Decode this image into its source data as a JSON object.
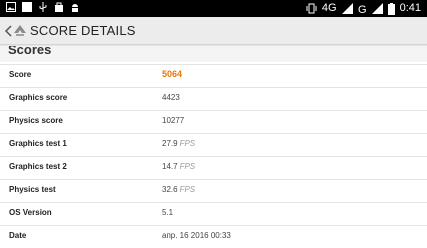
{
  "status_bar": {
    "network": "4G",
    "time": "0:41"
  },
  "app_bar": {
    "title": "SCORE DETAILS"
  },
  "section": {
    "title": "Scores"
  },
  "rows": [
    {
      "label": "Score",
      "value": "5064",
      "unit": ""
    },
    {
      "label": "Graphics score",
      "value": "4423",
      "unit": ""
    },
    {
      "label": "Physics score",
      "value": "10277",
      "unit": ""
    },
    {
      "label": "Graphics test 1",
      "value": "27.9",
      "unit": "FPS"
    },
    {
      "label": "Graphics test 2",
      "value": "14.7",
      "unit": "FPS"
    },
    {
      "label": "Physics test",
      "value": "32.6",
      "unit": "FPS"
    },
    {
      "label": "OS Version",
      "value": "5.1",
      "unit": ""
    },
    {
      "label": "Date",
      "value": "апр. 16 2016 00:33",
      "unit": ""
    }
  ],
  "colors": {
    "accent": "#e8760c",
    "statusbar": "#000000"
  }
}
